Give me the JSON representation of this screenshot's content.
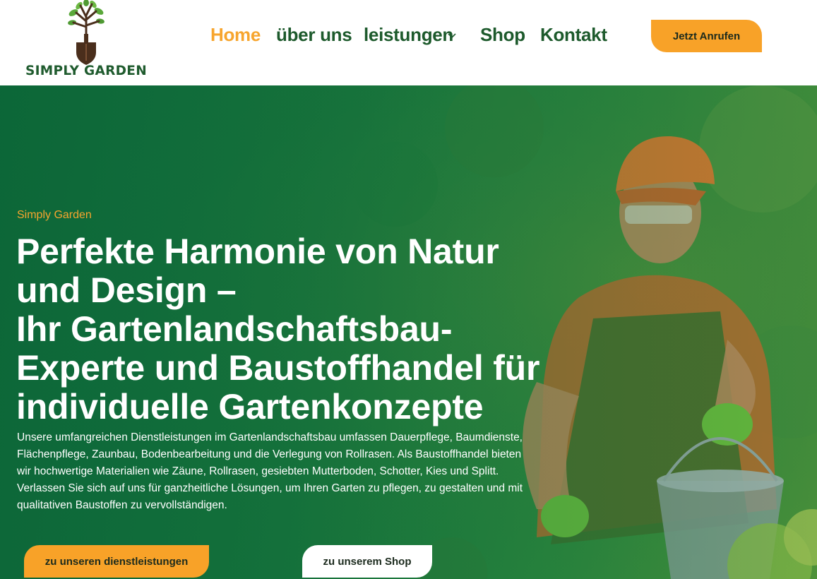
{
  "brand": {
    "logo_text": "SIMPLY GARDEN",
    "logo_icon": "tree-spade-icon",
    "colors": {
      "primary_green": "#1d5a2c",
      "accent_orange": "#f7a52e",
      "hero_green": "#17753e"
    }
  },
  "nav": {
    "items": [
      {
        "label": "Home",
        "active": true
      },
      {
        "label": "über uns",
        "active": false
      },
      {
        "label": "leistungen",
        "active": false,
        "has_dropdown": true
      },
      {
        "label": "Shop",
        "active": false
      },
      {
        "label": "Kontakt",
        "active": false
      }
    ],
    "dropdown_icon": "chevron-down-icon",
    "call_button": "Jetzt Anrufen"
  },
  "hero": {
    "eyebrow": "Simply Garden",
    "headline_lines": [
      "Perfekte Harmonie von Natur",
      "und Design –",
      "Ihr Gartenlandschaftsbau-",
      "Experte und Baustoffhandel für",
      "individuelle Gartenkonzepte"
    ],
    "description_lines": [
      "Unsere umfangreichen Dienstleistungen im Gartenlandschaftsbau umfassen Dauerpflege, Baumdienste,",
      "Flächenpflege, Zaunbau, Bodenbearbeitung und die Verlegung von Rollrasen. Als Baustoffhandel bieten",
      "wir hochwertige Materialien wie Zäune, Rollrasen, gesiebten Mutterboden, Schotter, Kies und Splitt.",
      "Verlassen Sie sich auf uns für ganzheitliche Lösungen, um Ihren Garten zu pflegen, zu gestalten und mit",
      "qualitativen Baustoffen zu vervollständigen."
    ],
    "buttons": {
      "services": "zu unseren dienstleistungen",
      "shop": "zu unserem Shop"
    }
  }
}
